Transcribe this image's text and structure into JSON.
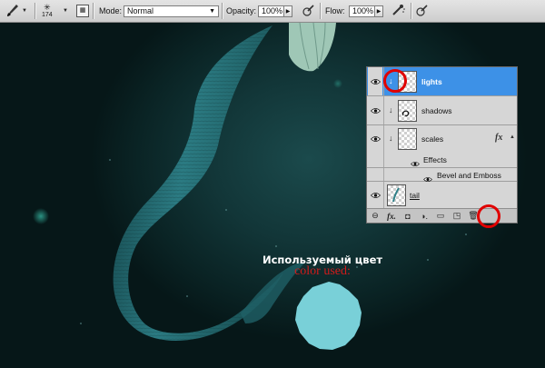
{
  "options_bar": {
    "brush_size": "174",
    "mode_label": "Mode:",
    "mode_value": "Normal",
    "opacity_label": "Opacity:",
    "opacity_value": "100%",
    "flow_label": "Flow:",
    "flow_value": "100%"
  },
  "layers_panel": {
    "layers": [
      {
        "name": "lights",
        "selected": true
      },
      {
        "name": "shadows",
        "selected": false
      },
      {
        "name": "scales",
        "selected": false,
        "fx": "fx"
      },
      {
        "name": "tail",
        "selected": false
      }
    ],
    "effects_label": "Effects",
    "effect_item": "Bevel and Emboss"
  },
  "caption": {
    "russian": "Используемый цвет",
    "english": "color used:"
  },
  "colors": {
    "used_color": "#79d0d8",
    "selection_blue": "#3d91e7",
    "highlight_red": "#e00000",
    "caption_red": "#d21b1b"
  }
}
